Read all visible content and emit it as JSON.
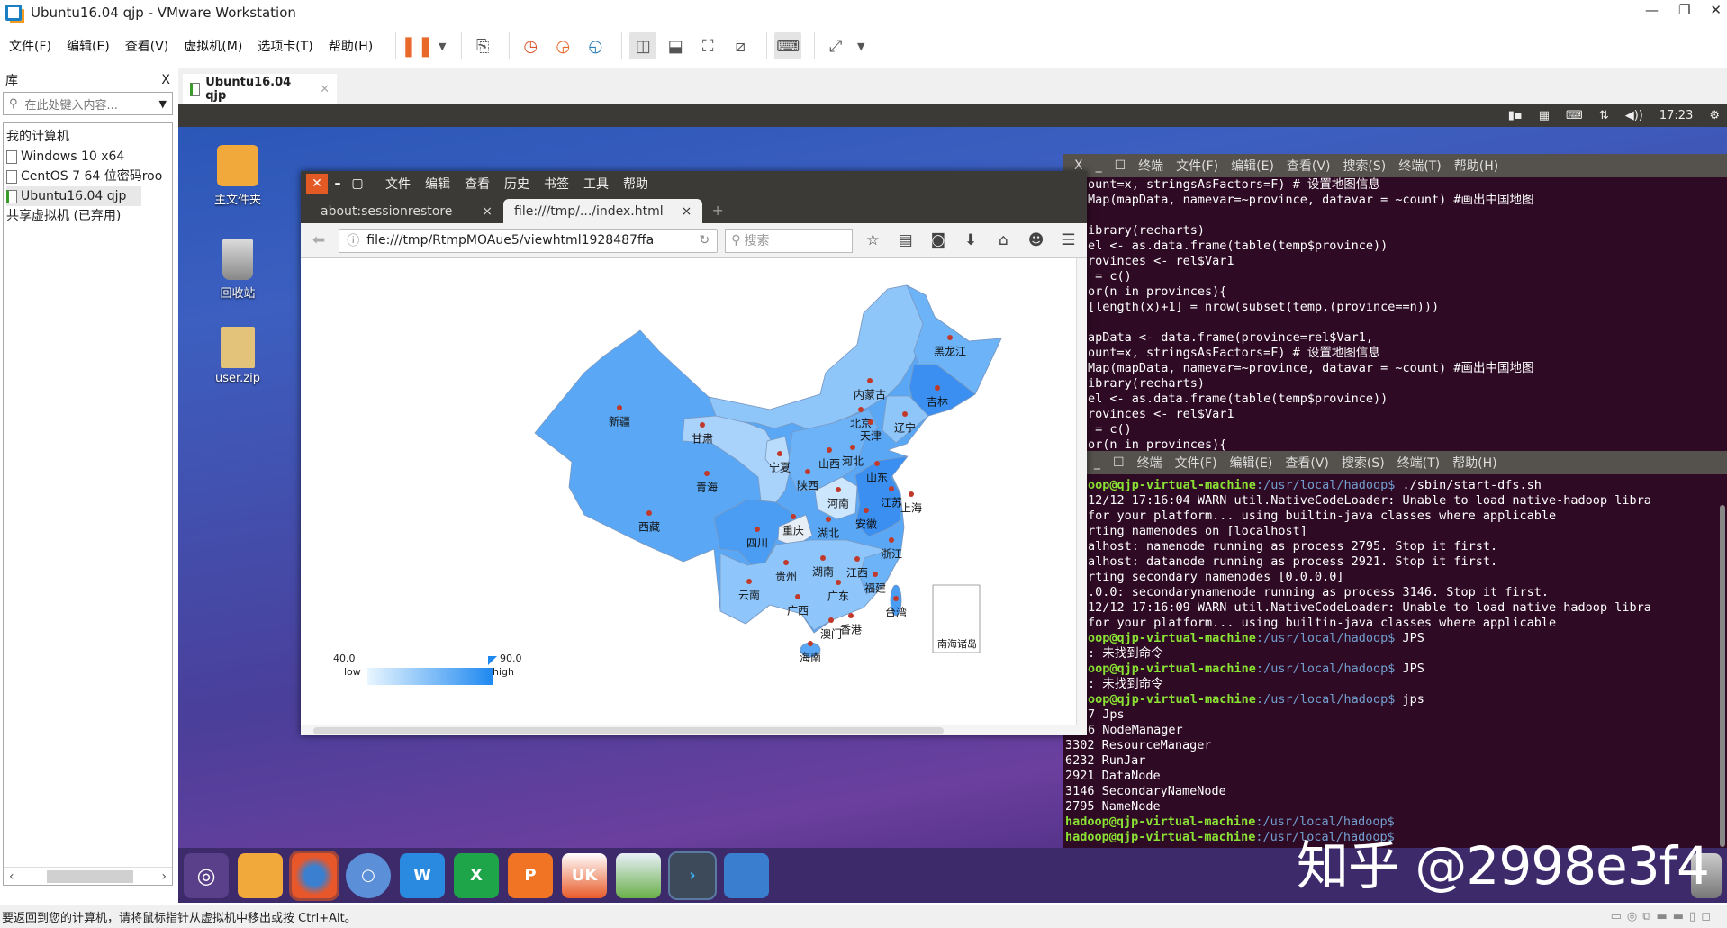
{
  "window": {
    "title": "Ubuntu16.04  qjp - VMware Workstation",
    "minimize": "—",
    "restore": "❐",
    "close": "✕"
  },
  "menu": [
    "文件(F)",
    "编辑(E)",
    "查看(V)",
    "虚拟机(M)",
    "选项卡(T)",
    "帮助(H)"
  ],
  "library": {
    "title": "库",
    "close": "X",
    "search_placeholder": "在此处键入内容...",
    "items": [
      "我的计算机",
      "Windows 10 x64",
      "CentOS 7 64 位密码roo",
      "Ubuntu16.04  qjp",
      "共享虚拟机 (已弃用)"
    ]
  },
  "vm_tab": {
    "label": "Ubuntu16.04  qjp",
    "close": "✕"
  },
  "ubuntu_panel": {
    "time": "17:23"
  },
  "desktop_icons": [
    "主文件夹",
    "回收站",
    "user.zip"
  ],
  "firefox": {
    "menu": [
      "文件",
      "编辑",
      "查看",
      "历史",
      "书签",
      "工具",
      "帮助"
    ],
    "tabs": [
      {
        "label": "about:sessionrestore",
        "close": "×"
      },
      {
        "label": "file:///tmp/.../index.html",
        "close": "×"
      }
    ],
    "new_tab": "+",
    "url": "file:///tmp/RtmpMOAue5/viewhtml1928487ffa",
    "search_placeholder": "搜索"
  },
  "map": {
    "provinces": [
      "黑龙江",
      "吉林",
      "内蒙古",
      "辽宁",
      "北京",
      "天津",
      "新疆",
      "甘肃",
      "宁夏",
      "山西",
      "河北",
      "山东",
      "青海",
      "陕西",
      "河南",
      "江苏",
      "上海",
      "西藏",
      "安徽",
      "重庆",
      "湖北",
      "四川",
      "浙江",
      "贵州",
      "湖南",
      "江西",
      "福建",
      "云南",
      "广东",
      "广西",
      "台湾",
      "香港",
      "澳门",
      "海南"
    ],
    "inset_label": "南海诸岛",
    "legend": {
      "min": "40.0",
      "max": "90.0",
      "low": "low",
      "high": "high",
      "color_low": "#e8f6ff",
      "color_high": "#1e88f0"
    }
  },
  "terminal1": {
    "menu": [
      "终端",
      "文件(F)",
      "编辑(E)",
      "查看(V)",
      "搜索(S)",
      "终端(T)",
      "帮助(H)"
    ],
    "lines": [
      "ount=x, stringsAsFactors=F) # 设置地图信息",
      "Map(mapData, namevar=~province, datavar = ~count) #画出中国地图",
      "",
      "ibrary(recharts)",
      "el <- as.data.frame(table(temp$province))",
      "rovinces <- rel$Var1",
      " = c()",
      "or(n in provinces){",
      "[length(x)+1] = nrow(subset(temp,(province==n)))",
      "",
      "apData <- data.frame(province=rel$Var1,",
      "ount=x, stringsAsFactors=F) # 设置地图信息",
      "Map(mapData, namevar=~province, datavar = ~count) #画出中国地图",
      "ibrary(recharts)",
      "el <- as.data.frame(table(temp$province))",
      "rovinces <- rel$Var1",
      " = c()",
      "or(n in provinces){"
    ]
  },
  "terminal2": {
    "menu": [
      "终端",
      "文件(F)",
      "编辑(E)",
      "查看(V)",
      "搜索(S)",
      "终端(T)",
      "帮助(H)"
    ],
    "prompt_user": "oop@qjp-virtual-machine",
    "prompt_user_full": "hadoop@qjp-virtual-machine",
    "prompt_path": ":/usr/local/hadoop$",
    "lines": [
      {
        "u": "oop@qjp-virtual-machine",
        "p": ":/usr/local/hadoop$",
        "t": " ./sbin/start-dfs.sh"
      },
      {
        "t": "12/12 17:16:04 WARN util.NativeCodeLoader: Unable to load native-hadoop libra"
      },
      {
        "t": "for your platform... using builtin-java classes where applicable"
      },
      {
        "t": "rting namenodes on [localhost]"
      },
      {
        "t": "alhost: namenode running as process 2795. Stop it first."
      },
      {
        "t": "alhost: datanode running as process 2921. Stop it first."
      },
      {
        "t": "rting secondary namenodes [0.0.0.0]"
      },
      {
        "t": ".0.0: secondarynamenode running as process 3146. Stop it first."
      },
      {
        "t": "12/12 17:16:09 WARN util.NativeCodeLoader: Unable to load native-hadoop libra"
      },
      {
        "t": "for your platform... using builtin-java classes where applicable"
      },
      {
        "u": "oop@qjp-virtual-machine",
        "p": ":/usr/local/hadoop$",
        "t": " JPS"
      },
      {
        "t": ": 未找到命令"
      },
      {
        "u": "oop@qjp-virtual-machine",
        "p": ":/usr/local/hadoop$",
        "t": " JPS"
      },
      {
        "t": ": 未找到命令"
      },
      {
        "u": "oop@qjp-virtual-machine",
        "p": ":/usr/local/hadoop$",
        "t": " jps"
      },
      {
        "t": "7 Jps"
      },
      {
        "t": "6 NodeManager"
      },
      {
        "t": "3302 ResourceManager",
        "full": true
      },
      {
        "t": "6232 RunJar",
        "full": true
      },
      {
        "t": "2921 DataNode",
        "full": true
      },
      {
        "t": "3146 SecondaryNameNode",
        "full": true
      },
      {
        "t": "2795 NameNode",
        "full": true
      },
      {
        "u": "hadoop@qjp-virtual-machine",
        "p": ":/usr/local/hadoop$",
        "t": "",
        "full": true
      },
      {
        "u": "hadoop@qjp-virtual-machine",
        "p": ":/usr/local/hadoop$",
        "t": "",
        "full": true
      }
    ]
  },
  "watermark": "知乎 @2998e3f4",
  "status_bar": "要返回到您的计算机，请将鼠标指针从虚拟机中移出或按 Ctrl+Alt。",
  "colors": {
    "terminal_bg": "#2f0a24",
    "prompt_green": "#8ae234",
    "prompt_blue": "#729fcf",
    "ff_close": "#e35a24"
  }
}
